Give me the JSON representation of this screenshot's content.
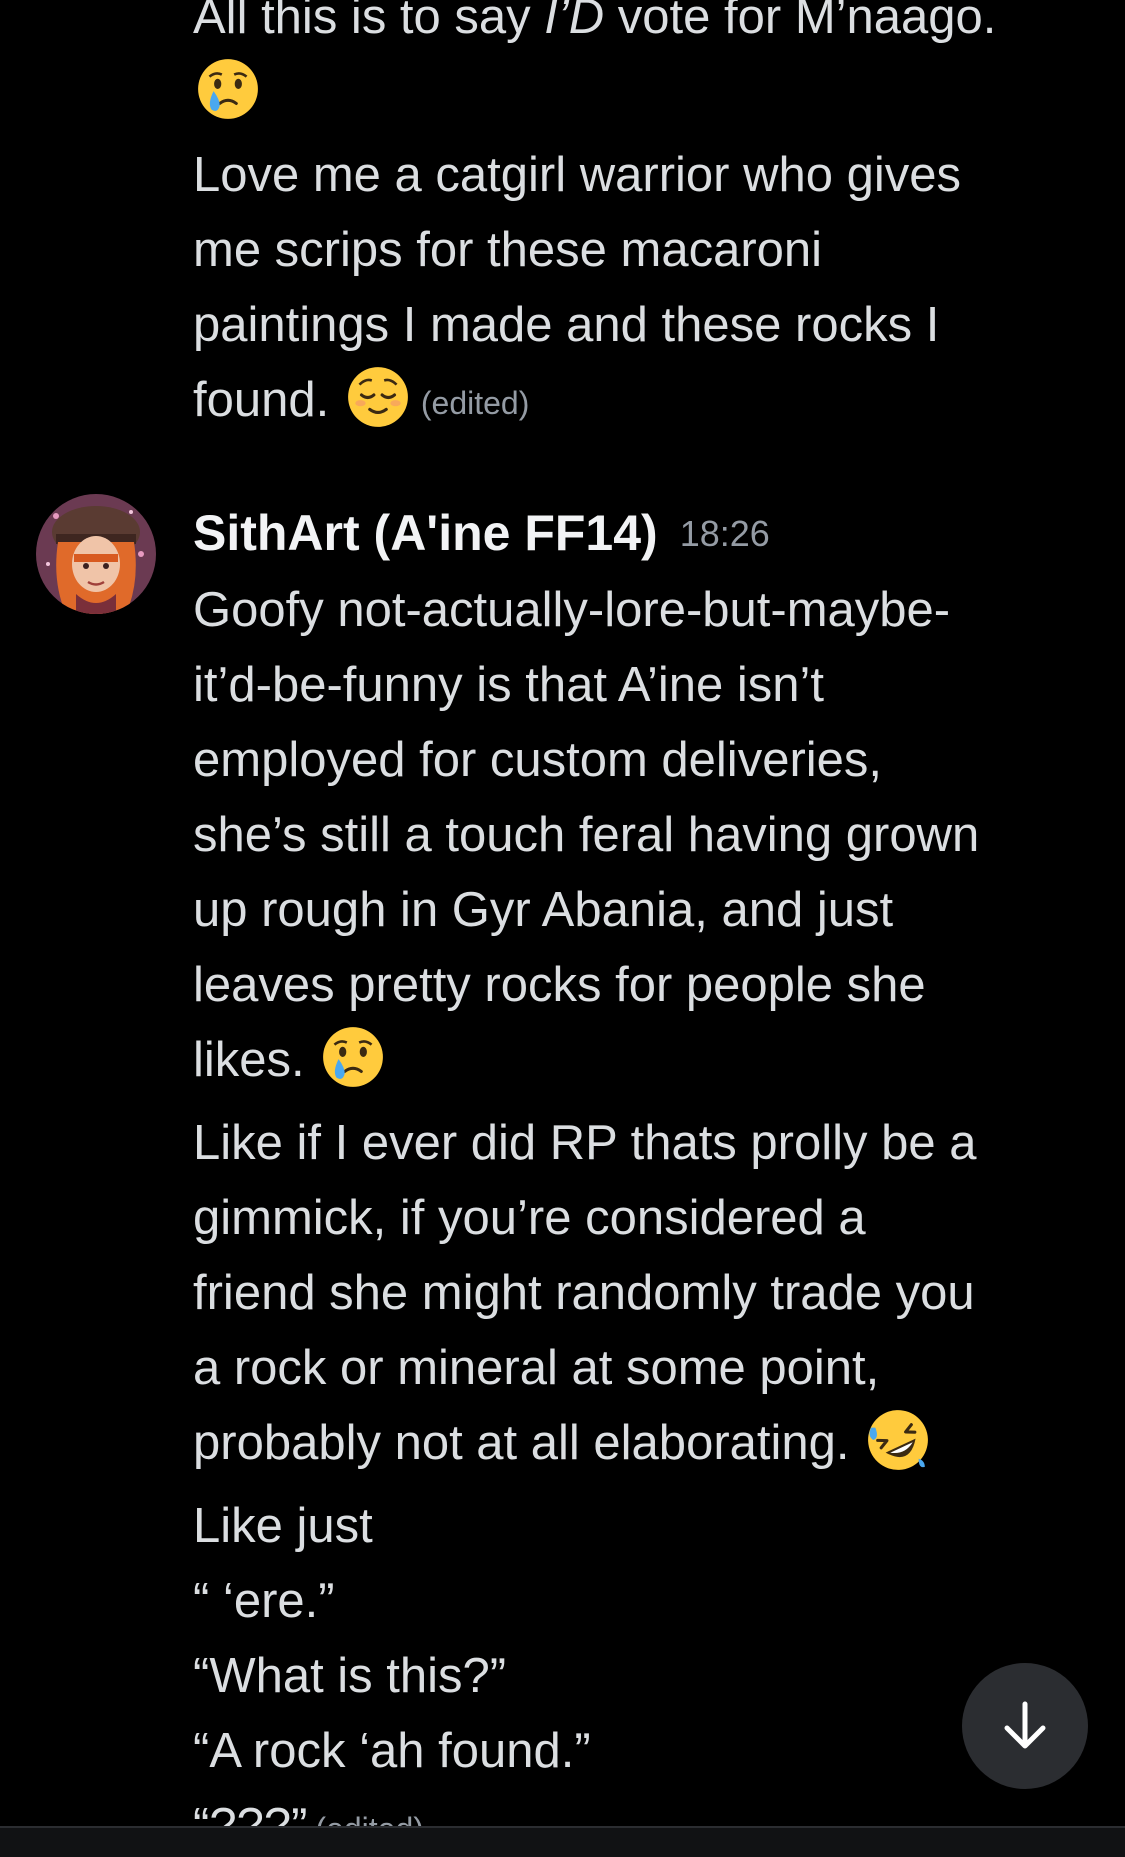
{
  "messages": [
    {
      "continuation": true,
      "lines": [
        {
          "pre": "All this is to say ",
          "em": "I’D",
          "post": " vote for M’naago.",
          "emoji": null
        },
        {
          "pre": "",
          "em": "",
          "post": "",
          "emoji": "crying-face"
        }
      ],
      "paragraph2": [
        "Love me a catgirl warrior who gives",
        "me scrips for these macaroni",
        "paintings I made and these rocks I",
        "found. "
      ],
      "edited_label": "(edited)"
    },
    {
      "author": "SithArt (A'ine FF14)",
      "timestamp": "18:26",
      "paragraph1": [
        "Goofy not-actually-lore-but-maybe-",
        "it’d-be-funny is that A’ine isn’t",
        "employed for custom deliveries,",
        "she’s still a touch feral having grown",
        "up rough in Gyr Abania, and just",
        "leaves pretty rocks for people she",
        "likes. "
      ],
      "paragraph2": [
        "Like if I ever did RP thats prolly be a",
        "gimmick, if you’re considered a",
        "friend she might randomly trade you",
        "a rock or mineral at some point,",
        "probably not at all elaborating. "
      ],
      "paragraph3": [
        "Like just",
        "“ ‘ere.”",
        "“What is this?”",
        "“A rock ‘ah found.”",
        "“???”"
      ],
      "edited_label": "(edited)"
    }
  ],
  "icons": {
    "avatar": "user-avatar",
    "scroll": "arrow-down-icon"
  },
  "colors": {
    "background": "#000000",
    "text": "#dbdee1",
    "muted": "#949ba4",
    "username": "#f2f3f5",
    "button": "#2b2d31"
  }
}
